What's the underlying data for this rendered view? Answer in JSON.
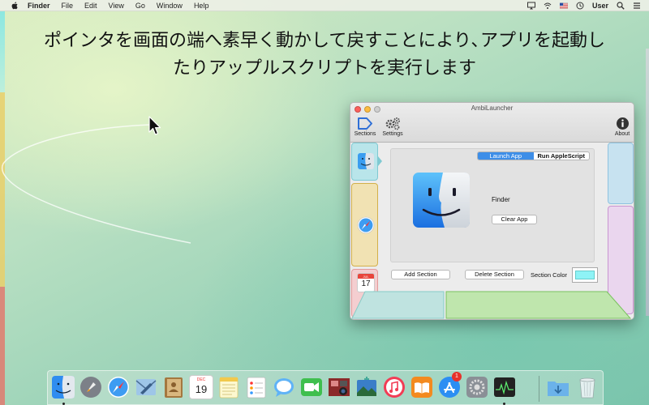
{
  "menubar": {
    "app_name": "Finder",
    "items": [
      "File",
      "Edit",
      "View",
      "Go",
      "Window",
      "Help"
    ],
    "user": "User",
    "icons": [
      "apple-icon",
      "airplay-icon",
      "wifi-icon",
      "flag-icon",
      "time-machine-icon",
      "search-icon",
      "list-icon"
    ]
  },
  "caption": {
    "line1": "ポインタを画面の端へ素早く動かして戻すことにより､アプリを起動し",
    "line2": "たりアップルスクリプトを実行します"
  },
  "window": {
    "title": "AmbiLauncher",
    "toolbar": {
      "sections_label": "Sections",
      "settings_label": "Settings",
      "about_label": "About"
    },
    "segments": {
      "launch_app": "Launch App",
      "run_applescript": "Run AppleScript",
      "selected": "Launch App"
    },
    "app_name": "Finder",
    "clear_app_label": "Clear App",
    "add_section_label": "Add Section",
    "delete_section_label": "Delete Section",
    "section_color_label": "Section Color",
    "section_color": "#8ef3f6",
    "section_calendar": {
      "month": "JUL",
      "day": "17"
    },
    "section_colors": {
      "left_1": "#b9e5ea",
      "left_2": "#f1e2b3",
      "left_3": "#f4ced0",
      "right_1": "#c7e2f0",
      "right_2": "#ead6ee",
      "bottom_1": "#bfe3e0",
      "bottom_2": "#bfe6ad"
    }
  },
  "dock": {
    "apps": [
      "finder-icon",
      "launchpad-icon",
      "safari-icon",
      "mail-icon",
      "contacts-icon",
      "calendar-icon",
      "notes-icon",
      "reminders-icon",
      "messages-icon",
      "facetime-icon",
      "photo-booth-icon",
      "iphoto-icon",
      "itunes-icon",
      "ibooks-icon",
      "app-store-icon",
      "system-preferences-icon",
      "activity-monitor-icon",
      "downloads-folder-icon",
      "trash-icon"
    ],
    "calendar": {
      "month": "DEC",
      "day": "19"
    },
    "app_store_badge": "1"
  }
}
